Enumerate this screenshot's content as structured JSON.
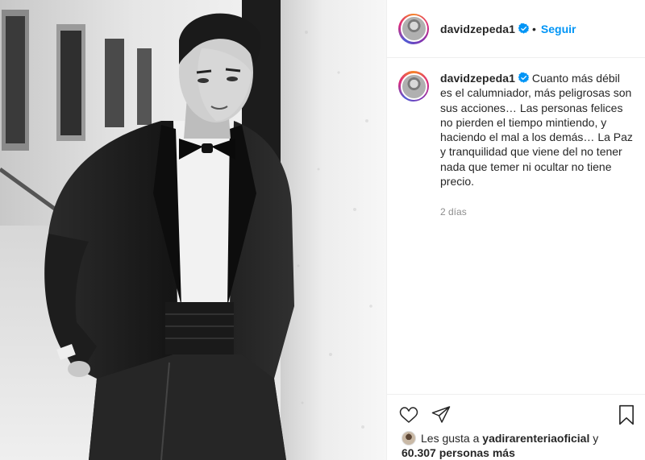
{
  "post": {
    "username": "davidzepeda1",
    "verified": true,
    "follow_label": "Seguir",
    "separator": "•"
  },
  "caption": {
    "username": "davidzepeda1",
    "text": "Cuanto más débil es el calumniador, más peligrosas son sus acciones… Las personas felices no pierden el tiempo mintiendo, y haciendo el mal a los demás… La Paz y tranquilidad que viene del no tener nada que temer ni ocultar no tiene precio.",
    "time": "2 días"
  },
  "likes": {
    "prefix": "Les gusta a",
    "user": "yadirarenteriaoficial",
    "conj": "y",
    "count_text": "60.307 personas más"
  },
  "icons": {
    "like": "heart-icon",
    "share": "send-icon",
    "save": "bookmark-icon",
    "verified": "verified-badge-icon"
  },
  "colors": {
    "accent": "#0095f6",
    "text": "#262626",
    "muted": "#8e8e8e",
    "divider": "#efefef"
  }
}
